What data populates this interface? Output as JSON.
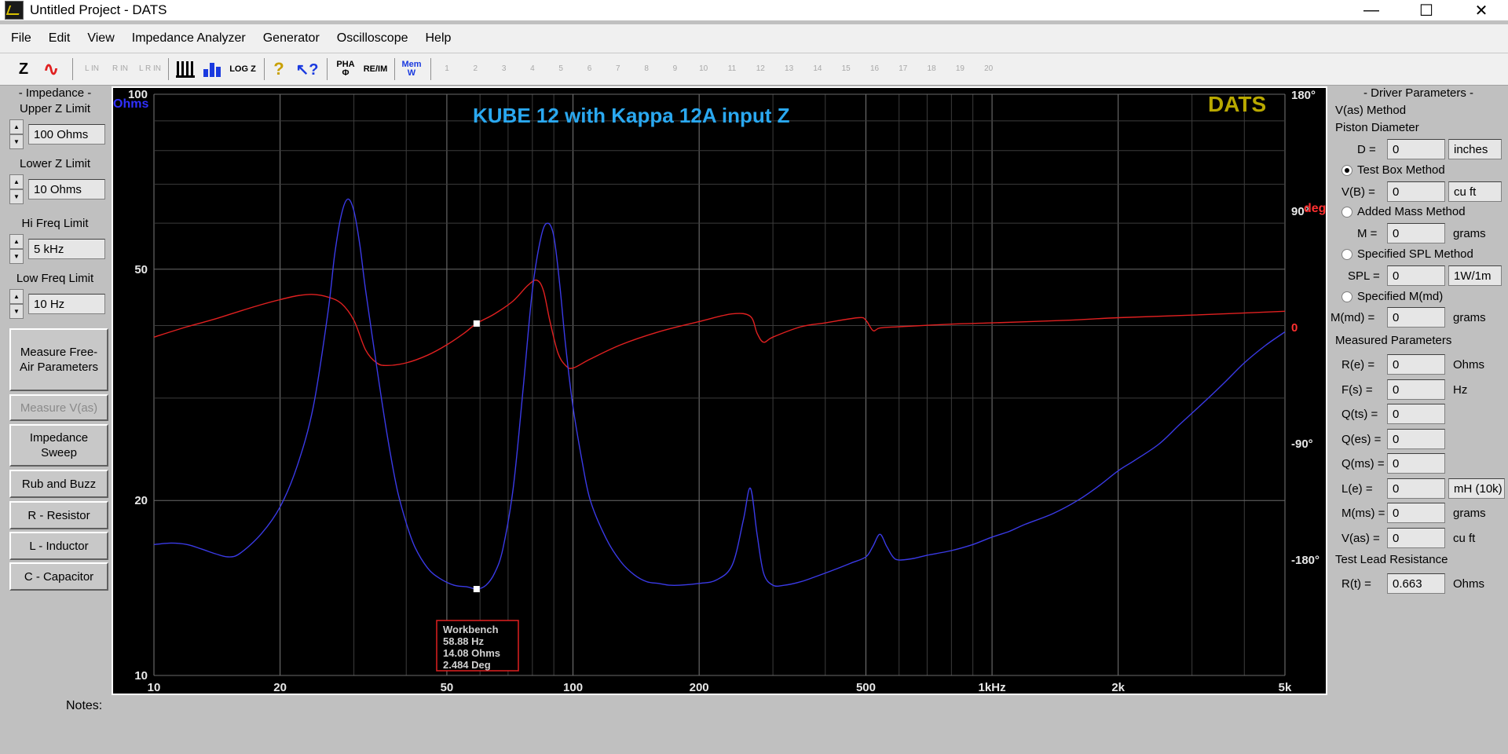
{
  "window": {
    "title": "Untitled Project - DATS",
    "minimize": "—",
    "maximize": "☐",
    "close": "✕"
  },
  "menu": [
    "File",
    "Edit",
    "View",
    "Impedance Analyzer",
    "Generator",
    "Oscilloscope",
    "Help"
  ],
  "toolbar": {
    "z": "Z",
    "sine": "∿",
    "lin": "L IN",
    "rin": "R IN",
    "lrin": "L R IN",
    "log": "LOG Z",
    "pha": "PHA Φ",
    "reim": "RE/IM",
    "mem": "Mem W",
    "mem_slots": [
      "1",
      "2",
      "3",
      "4",
      "5",
      "6",
      "7",
      "8",
      "9",
      "10",
      "11",
      "12",
      "13",
      "14",
      "15",
      "16",
      "17",
      "18",
      "19",
      "20"
    ]
  },
  "left": {
    "impedance_title": "- Impedance -",
    "upper_label": "Upper Z Limit",
    "upper_value": "100 Ohms",
    "lower_label": "Lower Z Limit",
    "lower_value": "10 Ohms",
    "hi_label": "Hi Freq Limit",
    "hi_value": "5 kHz",
    "low_label": "Low Freq Limit",
    "low_value": "10 Hz",
    "btn_freeair": "Measure Free-Air Parameters",
    "btn_vas": "Measure V(as)",
    "btn_sweep": "Impedance Sweep",
    "btn_rub": "Rub and Buzz",
    "btn_r": "R - Resistor",
    "btn_l": "L - Inductor",
    "btn_c": "C - Capacitor"
  },
  "notes_label": "Notes:",
  "chart_data": {
    "type": "line",
    "title": "KUBE 12  with Kappa 12A input Z",
    "watermark": "DATS",
    "y_unit_label": "Ohms",
    "phase_unit_label": "deg",
    "xscale": "log",
    "xlim": [
      10,
      5000
    ],
    "yscale": "log",
    "ylim": [
      10,
      100
    ],
    "y2lim": [
      -270,
      180
    ],
    "x_ticks": [
      10,
      20,
      50,
      100,
      200,
      500,
      1000,
      2000,
      5000
    ],
    "x_tick_labels": [
      "10",
      "20",
      "50",
      "100",
      "200",
      "500",
      "1kHz",
      "2k",
      "5k"
    ],
    "y_ticks": [
      10,
      20,
      50,
      100
    ],
    "y_tick_labels": [
      "10",
      "20",
      "50",
      "100"
    ],
    "y2_ticks": [
      180,
      90,
      0,
      -90,
      -180
    ],
    "y2_tick_labels": [
      "180°",
      "90°",
      "0",
      "-90°",
      "-180°"
    ],
    "grid": true,
    "series": [
      {
        "color": "#3a3ae6",
        "axis": "impedance",
        "x": [
          10,
          11,
          12,
          13,
          14,
          15,
          16,
          18,
          20,
          22,
          24,
          26,
          27,
          28,
          29,
          30,
          31,
          32,
          34,
          36,
          38,
          40,
          42,
          45,
          48,
          52,
          56,
          59,
          62,
          65,
          68,
          72,
          76,
          80,
          84,
          87,
          90,
          93,
          96,
          100,
          105,
          110,
          120,
          130,
          140,
          150,
          160,
          170,
          180,
          200,
          220,
          240,
          255,
          265,
          275,
          285,
          300,
          320,
          350,
          380,
          420,
          460,
          500,
          520,
          540,
          560,
          580,
          600,
          650,
          700,
          800,
          900,
          1000,
          1100,
          1200,
          1400,
          1600,
          1800,
          2000,
          2200,
          2500,
          2800,
          3200,
          3600,
          4000,
          4500,
          5000
        ],
        "values": [
          16.8,
          16.9,
          16.8,
          16.5,
          16.2,
          16.0,
          16.2,
          17.5,
          19.5,
          23,
          29,
          42,
          53,
          62,
          66,
          63,
          55,
          46,
          34,
          26,
          21,
          18.3,
          16.6,
          15.3,
          14.7,
          14.3,
          14.2,
          14.08,
          14.3,
          15.0,
          16.5,
          21,
          31,
          46,
          57,
          60,
          57,
          47,
          37,
          29,
          23.5,
          20,
          17.2,
          15.7,
          14.9,
          14.5,
          14.4,
          14.3,
          14.3,
          14.4,
          14.6,
          15.5,
          18.5,
          21,
          17.5,
          15,
          14.3,
          14.3,
          14.5,
          14.8,
          15.2,
          15.6,
          16.0,
          16.7,
          17.5,
          16.7,
          16.0,
          15.8,
          15.9,
          16.1,
          16.4,
          16.8,
          17.3,
          17.7,
          18.2,
          19.0,
          20.0,
          21.2,
          22.5,
          23.5,
          25.0,
          27.0,
          29.5,
          32.0,
          34.5,
          37.0,
          39.0
        ]
      },
      {
        "color": "#e02020",
        "axis": "phase",
        "x": [
          10,
          12,
          14,
          16,
          18,
          20,
          22,
          24,
          26,
          28,
          30,
          32,
          34,
          36,
          40,
          45,
          50,
          55,
          58.88,
          65,
          72,
          78,
          82,
          85,
          88,
          92,
          96,
          100,
          110,
          130,
          160,
          200,
          240,
          265,
          275,
          285,
          300,
          350,
          400,
          480,
          500,
          520,
          540,
          600,
          800,
          1000,
          1500,
          2000,
          3000,
          5000
        ],
        "values": [
          -8,
          0,
          6,
          12,
          17,
          21,
          24,
          25,
          23,
          18,
          5,
          -18,
          -28,
          -30,
          -28,
          -22,
          -14,
          -5,
          2.5,
          10,
          20,
          32,
          36,
          28,
          5,
          -20,
          -30,
          -32,
          -25,
          -14,
          -4,
          4,
          10,
          8,
          -5,
          -12,
          -8,
          0,
          3,
          7,
          5,
          -3,
          -1,
          0,
          2,
          3,
          5,
          7,
          9,
          12
        ]
      }
    ],
    "cursor": {
      "x": 58.88,
      "z": 14.08,
      "phase": 2.484
    },
    "cursor_box": {
      "title": "Workbench",
      "freq": "58.88 Hz",
      "ohms": "14.08 Ohms",
      "deg": "2.484 Deg"
    }
  },
  "right": {
    "driver_title": "- Driver Parameters -",
    "vas_method": "V(as) Method",
    "piston_label": "Piston Diameter",
    "d_label": "D =",
    "d_value": "0",
    "d_unit": "inches",
    "test_box": "Test Box Method",
    "vb_label": "V(B) =",
    "vb_value": "0",
    "vb_unit": "cu ft",
    "added_mass": "Added Mass Method",
    "m_label": "M =",
    "m_value": "0",
    "m_unit": "grams",
    "spl_method": "Specified SPL Method",
    "spl_label": "SPL =",
    "spl_value": "0",
    "spl_unit": "1W/1m",
    "mmd_method": "Specified M(md)",
    "mmd_label": "M(md) =",
    "mmd_value": "0",
    "mmd_unit": "grams",
    "measured_title": "Measured Parameters",
    "params": [
      {
        "label": "R(e) =",
        "value": "0",
        "unit": "Ohms"
      },
      {
        "label": "F(s) =",
        "value": "0",
        "unit": "Hz"
      },
      {
        "label": "Q(ts) =",
        "value": "0",
        "unit": ""
      },
      {
        "label": "Q(es) =",
        "value": "0",
        "unit": ""
      },
      {
        "label": "Q(ms) =",
        "value": "0",
        "unit": ""
      },
      {
        "label": "L(e) =",
        "value": "0",
        "unit": "mH (10k)"
      },
      {
        "label": "M(ms) =",
        "value": "0",
        "unit": "grams"
      },
      {
        "label": "V(as) =",
        "value": "0",
        "unit": "cu ft"
      }
    ],
    "lead_title": "Test Lead Resistance",
    "rt_label": "R(t) =",
    "rt_value": "0.663",
    "rt_unit": "Ohms"
  }
}
